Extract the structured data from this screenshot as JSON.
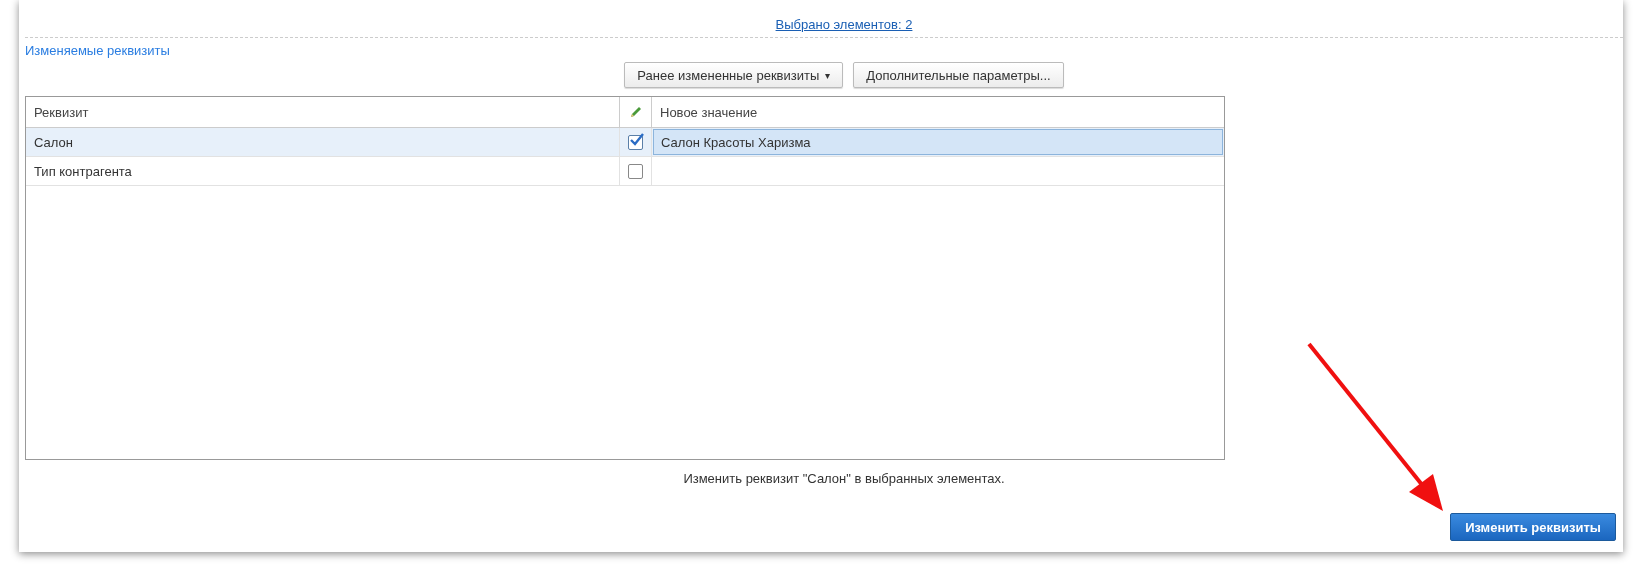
{
  "selection_link": "Выбрано элементов: 2",
  "section_title": "Изменяемые реквизиты",
  "toolbar": {
    "dropdown": {
      "label": "Ранее измененные реквизиты",
      "caret": "▾"
    },
    "button": "Дополнительные параметры..."
  },
  "table": {
    "columns": [
      "Реквизит",
      "Новое значение"
    ],
    "rows": [
      {
        "name": "Салон",
        "checked": true,
        "value": "Салон Красоты Харизма",
        "selected": true
      },
      {
        "name": "Тип контрагента",
        "checked": false,
        "value": "",
        "selected": false
      }
    ]
  },
  "hint": "Изменить реквизит \"Салон\" в выбранных элементах.",
  "submit_button": "Изменить реквизиты"
}
